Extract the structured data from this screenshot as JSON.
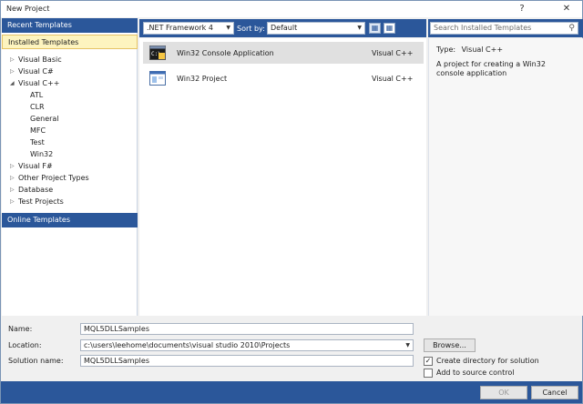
{
  "window": {
    "title": "New Project",
    "help": "?",
    "close": "✕"
  },
  "left": {
    "recent": "Recent Templates",
    "installed": "Installed Templates",
    "online": "Online Templates",
    "tree": [
      {
        "label": "Visual Basic",
        "arrow": "▷",
        "indent": 0
      },
      {
        "label": "Visual C#",
        "arrow": "▷",
        "indent": 0
      },
      {
        "label": "Visual C++",
        "arrow": "◢",
        "indent": 0
      },
      {
        "label": "ATL",
        "arrow": "",
        "indent": 1
      },
      {
        "label": "CLR",
        "arrow": "",
        "indent": 1
      },
      {
        "label": "General",
        "arrow": "",
        "indent": 1
      },
      {
        "label": "MFC",
        "arrow": "",
        "indent": 1
      },
      {
        "label": "Test",
        "arrow": "",
        "indent": 1
      },
      {
        "label": "Win32",
        "arrow": "",
        "indent": 1
      },
      {
        "label": "Visual F#",
        "arrow": "▷",
        "indent": 0
      },
      {
        "label": "Other Project Types",
        "arrow": "▷",
        "indent": 0
      },
      {
        "label": "Database",
        "arrow": "▷",
        "indent": 0
      },
      {
        "label": "Test Projects",
        "arrow": "▷",
        "indent": 0
      }
    ]
  },
  "toolbar": {
    "framework": ".NET Framework 4",
    "sort_label": "Sort by:",
    "sort_value": "Default",
    "search_placeholder": "Search Installed Templates"
  },
  "templates": [
    {
      "name": "Win32 Console Application",
      "lang": "Visual C++",
      "selected": true
    },
    {
      "name": "Win32 Project",
      "lang": "Visual C++",
      "selected": false
    }
  ],
  "description": {
    "type_label": "Type:",
    "type_value": "Visual C++",
    "text": "A project for creating a Win32 console application"
  },
  "form": {
    "name_label": "Name:",
    "name_value": "MQL5DLLSamples",
    "location_label": "Location:",
    "location_value": "c:\\users\\leehome\\documents\\visual studio 2010\\Projects",
    "solution_label": "Solution name:",
    "solution_value": "MQL5DLLSamples",
    "browse": "Browse...",
    "create_dir_label": "Create directory for solution",
    "create_dir_checked": true,
    "source_control_label": "Add to source control",
    "source_control_checked": false
  },
  "footer": {
    "ok": "OK",
    "cancel": "Cancel"
  },
  "colors": {
    "accent": "#2b579a",
    "selected_category": "#fdf4bf"
  }
}
